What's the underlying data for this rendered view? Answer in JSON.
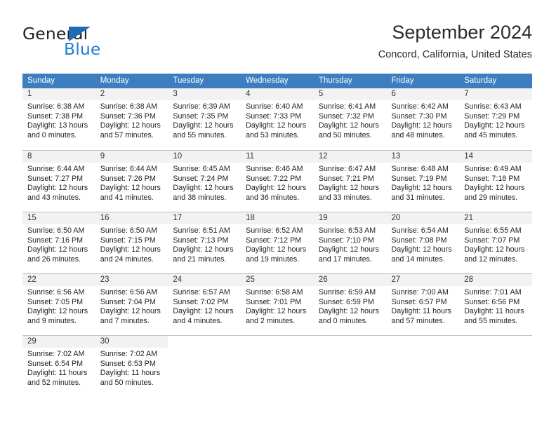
{
  "brand": {
    "name_part1": "General",
    "name_part2": "Blue",
    "accent_color": "#1f7fd4",
    "triangle_color": "#1f6cb4"
  },
  "header": {
    "month_title": "September 2024",
    "location": "Concord, California, United States"
  },
  "calendar": {
    "header_bg": "#3c7ebf",
    "daynum_bg": "#f2f2f2",
    "border_color": "#bfbfbf",
    "weekday_headers": [
      "Sunday",
      "Monday",
      "Tuesday",
      "Wednesday",
      "Thursday",
      "Friday",
      "Saturday"
    ],
    "weeks": [
      [
        {
          "day": "1",
          "sunrise": "Sunrise: 6:38 AM",
          "sunset": "Sunset: 7:38 PM",
          "daylight_line1": "Daylight: 13 hours",
          "daylight_line2": "and 0 minutes."
        },
        {
          "day": "2",
          "sunrise": "Sunrise: 6:38 AM",
          "sunset": "Sunset: 7:36 PM",
          "daylight_line1": "Daylight: 12 hours",
          "daylight_line2": "and 57 minutes."
        },
        {
          "day": "3",
          "sunrise": "Sunrise: 6:39 AM",
          "sunset": "Sunset: 7:35 PM",
          "daylight_line1": "Daylight: 12 hours",
          "daylight_line2": "and 55 minutes."
        },
        {
          "day": "4",
          "sunrise": "Sunrise: 6:40 AM",
          "sunset": "Sunset: 7:33 PM",
          "daylight_line1": "Daylight: 12 hours",
          "daylight_line2": "and 53 minutes."
        },
        {
          "day": "5",
          "sunrise": "Sunrise: 6:41 AM",
          "sunset": "Sunset: 7:32 PM",
          "daylight_line1": "Daylight: 12 hours",
          "daylight_line2": "and 50 minutes."
        },
        {
          "day": "6",
          "sunrise": "Sunrise: 6:42 AM",
          "sunset": "Sunset: 7:30 PM",
          "daylight_line1": "Daylight: 12 hours",
          "daylight_line2": "and 48 minutes."
        },
        {
          "day": "7",
          "sunrise": "Sunrise: 6:43 AM",
          "sunset": "Sunset: 7:29 PM",
          "daylight_line1": "Daylight: 12 hours",
          "daylight_line2": "and 45 minutes."
        }
      ],
      [
        {
          "day": "8",
          "sunrise": "Sunrise: 6:44 AM",
          "sunset": "Sunset: 7:27 PM",
          "daylight_line1": "Daylight: 12 hours",
          "daylight_line2": "and 43 minutes."
        },
        {
          "day": "9",
          "sunrise": "Sunrise: 6:44 AM",
          "sunset": "Sunset: 7:26 PM",
          "daylight_line1": "Daylight: 12 hours",
          "daylight_line2": "and 41 minutes."
        },
        {
          "day": "10",
          "sunrise": "Sunrise: 6:45 AM",
          "sunset": "Sunset: 7:24 PM",
          "daylight_line1": "Daylight: 12 hours",
          "daylight_line2": "and 38 minutes."
        },
        {
          "day": "11",
          "sunrise": "Sunrise: 6:46 AM",
          "sunset": "Sunset: 7:22 PM",
          "daylight_line1": "Daylight: 12 hours",
          "daylight_line2": "and 36 minutes."
        },
        {
          "day": "12",
          "sunrise": "Sunrise: 6:47 AM",
          "sunset": "Sunset: 7:21 PM",
          "daylight_line1": "Daylight: 12 hours",
          "daylight_line2": "and 33 minutes."
        },
        {
          "day": "13",
          "sunrise": "Sunrise: 6:48 AM",
          "sunset": "Sunset: 7:19 PM",
          "daylight_line1": "Daylight: 12 hours",
          "daylight_line2": "and 31 minutes."
        },
        {
          "day": "14",
          "sunrise": "Sunrise: 6:49 AM",
          "sunset": "Sunset: 7:18 PM",
          "daylight_line1": "Daylight: 12 hours",
          "daylight_line2": "and 29 minutes."
        }
      ],
      [
        {
          "day": "15",
          "sunrise": "Sunrise: 6:50 AM",
          "sunset": "Sunset: 7:16 PM",
          "daylight_line1": "Daylight: 12 hours",
          "daylight_line2": "and 26 minutes."
        },
        {
          "day": "16",
          "sunrise": "Sunrise: 6:50 AM",
          "sunset": "Sunset: 7:15 PM",
          "daylight_line1": "Daylight: 12 hours",
          "daylight_line2": "and 24 minutes."
        },
        {
          "day": "17",
          "sunrise": "Sunrise: 6:51 AM",
          "sunset": "Sunset: 7:13 PM",
          "daylight_line1": "Daylight: 12 hours",
          "daylight_line2": "and 21 minutes."
        },
        {
          "day": "18",
          "sunrise": "Sunrise: 6:52 AM",
          "sunset": "Sunset: 7:12 PM",
          "daylight_line1": "Daylight: 12 hours",
          "daylight_line2": "and 19 minutes."
        },
        {
          "day": "19",
          "sunrise": "Sunrise: 6:53 AM",
          "sunset": "Sunset: 7:10 PM",
          "daylight_line1": "Daylight: 12 hours",
          "daylight_line2": "and 17 minutes."
        },
        {
          "day": "20",
          "sunrise": "Sunrise: 6:54 AM",
          "sunset": "Sunset: 7:08 PM",
          "daylight_line1": "Daylight: 12 hours",
          "daylight_line2": "and 14 minutes."
        },
        {
          "day": "21",
          "sunrise": "Sunrise: 6:55 AM",
          "sunset": "Sunset: 7:07 PM",
          "daylight_line1": "Daylight: 12 hours",
          "daylight_line2": "and 12 minutes."
        }
      ],
      [
        {
          "day": "22",
          "sunrise": "Sunrise: 6:56 AM",
          "sunset": "Sunset: 7:05 PM",
          "daylight_line1": "Daylight: 12 hours",
          "daylight_line2": "and 9 minutes."
        },
        {
          "day": "23",
          "sunrise": "Sunrise: 6:56 AM",
          "sunset": "Sunset: 7:04 PM",
          "daylight_line1": "Daylight: 12 hours",
          "daylight_line2": "and 7 minutes."
        },
        {
          "day": "24",
          "sunrise": "Sunrise: 6:57 AM",
          "sunset": "Sunset: 7:02 PM",
          "daylight_line1": "Daylight: 12 hours",
          "daylight_line2": "and 4 minutes."
        },
        {
          "day": "25",
          "sunrise": "Sunrise: 6:58 AM",
          "sunset": "Sunset: 7:01 PM",
          "daylight_line1": "Daylight: 12 hours",
          "daylight_line2": "and 2 minutes."
        },
        {
          "day": "26",
          "sunrise": "Sunrise: 6:59 AM",
          "sunset": "Sunset: 6:59 PM",
          "daylight_line1": "Daylight: 12 hours",
          "daylight_line2": "and 0 minutes."
        },
        {
          "day": "27",
          "sunrise": "Sunrise: 7:00 AM",
          "sunset": "Sunset: 6:57 PM",
          "daylight_line1": "Daylight: 11 hours",
          "daylight_line2": "and 57 minutes."
        },
        {
          "day": "28",
          "sunrise": "Sunrise: 7:01 AM",
          "sunset": "Sunset: 6:56 PM",
          "daylight_line1": "Daylight: 11 hours",
          "daylight_line2": "and 55 minutes."
        }
      ],
      [
        {
          "day": "29",
          "sunrise": "Sunrise: 7:02 AM",
          "sunset": "Sunset: 6:54 PM",
          "daylight_line1": "Daylight: 11 hours",
          "daylight_line2": "and 52 minutes."
        },
        {
          "day": "30",
          "sunrise": "Sunrise: 7:02 AM",
          "sunset": "Sunset: 6:53 PM",
          "daylight_line1": "Daylight: 11 hours",
          "daylight_line2": "and 50 minutes."
        },
        {
          "day": "",
          "sunrise": "",
          "sunset": "",
          "daylight_line1": "",
          "daylight_line2": ""
        },
        {
          "day": "",
          "sunrise": "",
          "sunset": "",
          "daylight_line1": "",
          "daylight_line2": ""
        },
        {
          "day": "",
          "sunrise": "",
          "sunset": "",
          "daylight_line1": "",
          "daylight_line2": ""
        },
        {
          "day": "",
          "sunrise": "",
          "sunset": "",
          "daylight_line1": "",
          "daylight_line2": ""
        },
        {
          "day": "",
          "sunrise": "",
          "sunset": "",
          "daylight_line1": "",
          "daylight_line2": ""
        }
      ]
    ]
  }
}
